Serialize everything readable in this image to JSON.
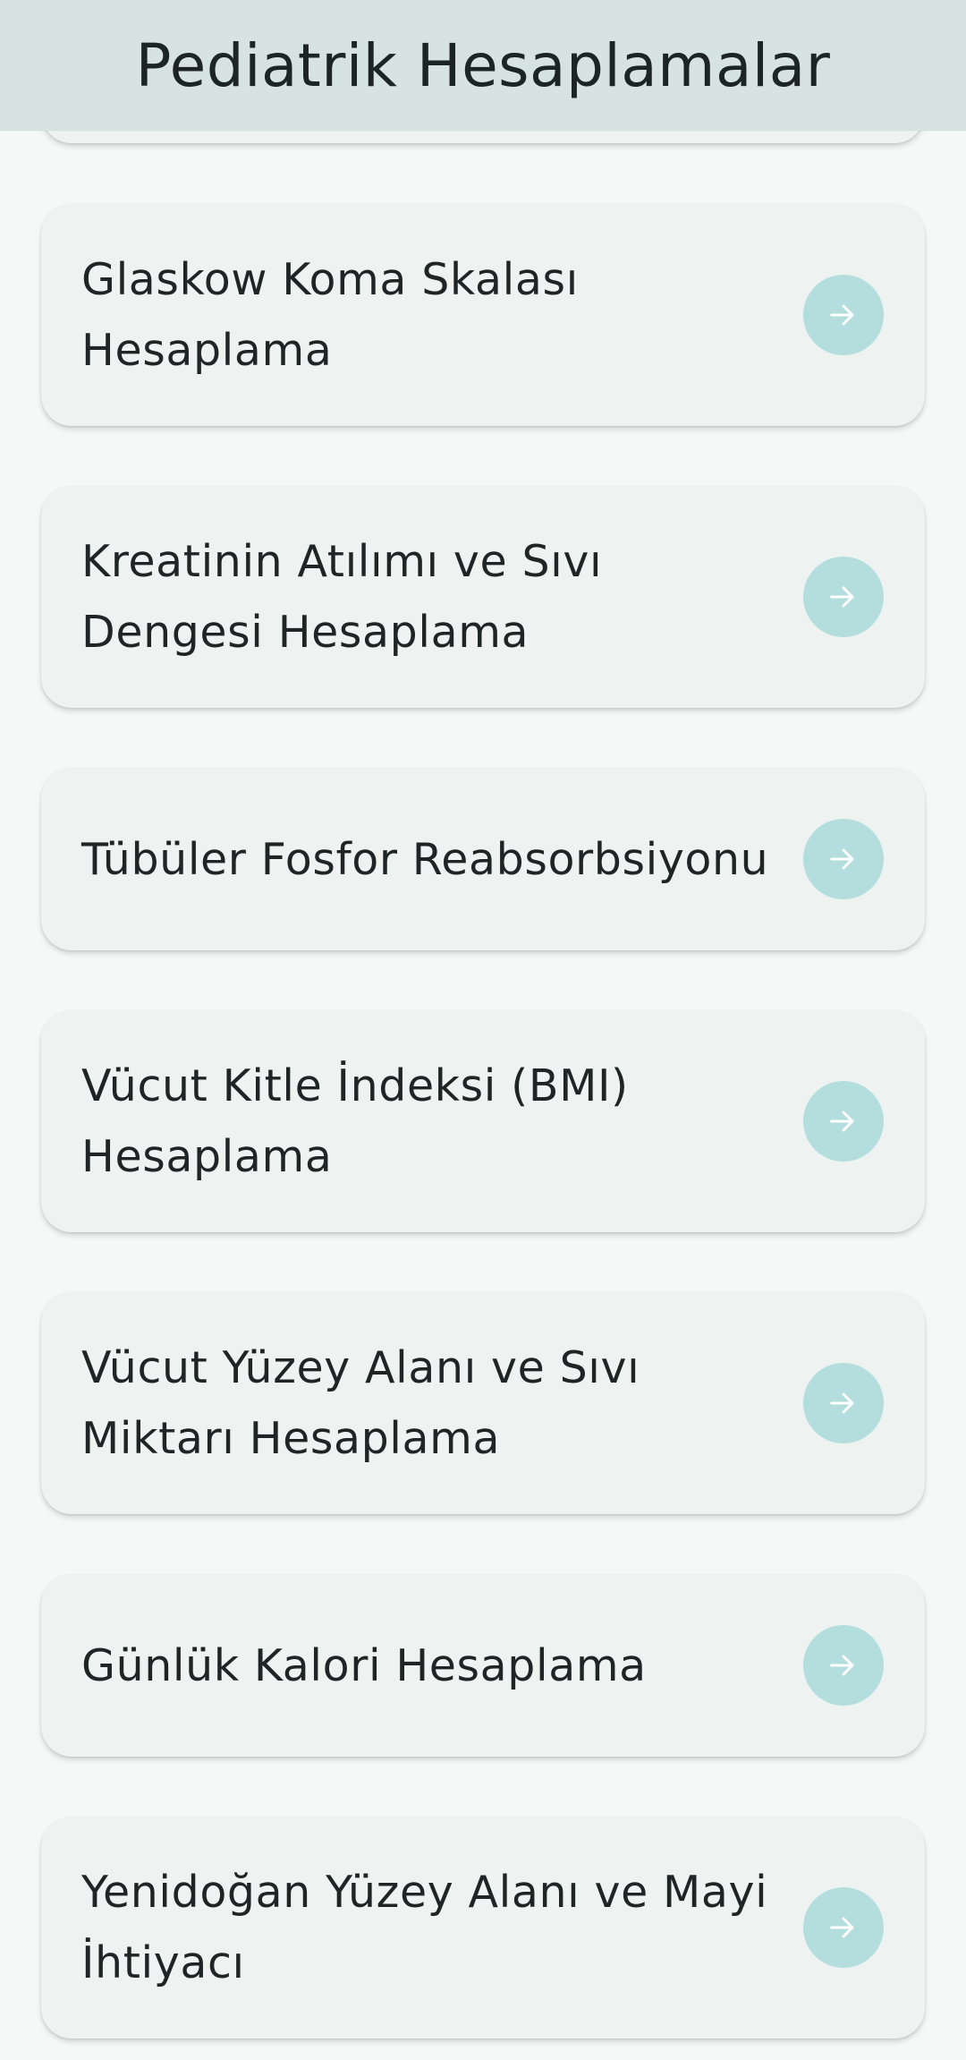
{
  "app_bar": {
    "title": "Pediatrik Hesaplamalar"
  },
  "colors": {
    "app_bar_bg": "#d7e3e1",
    "page_bg": "#f4f8f7",
    "card_bg": "#eef3f1",
    "arrow_circle": "#b3dedd",
    "text": "#1e2524"
  },
  "items": [
    {
      "label": "Glaskow Koma Skalası Hesaplama",
      "icon": "arrow-forward-icon"
    },
    {
      "label": "Kreatinin Atılımı ve Sıvı Dengesi Hesaplama",
      "icon": "arrow-forward-icon"
    },
    {
      "label": "Tübüler Fosfor Reabsorbsiyonu",
      "icon": "arrow-forward-icon"
    },
    {
      "label": "Vücut Kitle İndeksi (BMI) Hesaplama",
      "icon": "arrow-forward-icon"
    },
    {
      "label": "Vücut Yüzey Alanı ve Sıvı Miktarı Hesaplama",
      "icon": "arrow-forward-icon"
    },
    {
      "label": "Günlük Kalori Hesaplama",
      "icon": "arrow-forward-icon"
    },
    {
      "label": "Yenidoğan Yüzey Alanı ve Mayi İhtiyacı",
      "icon": "arrow-forward-icon"
    }
  ]
}
